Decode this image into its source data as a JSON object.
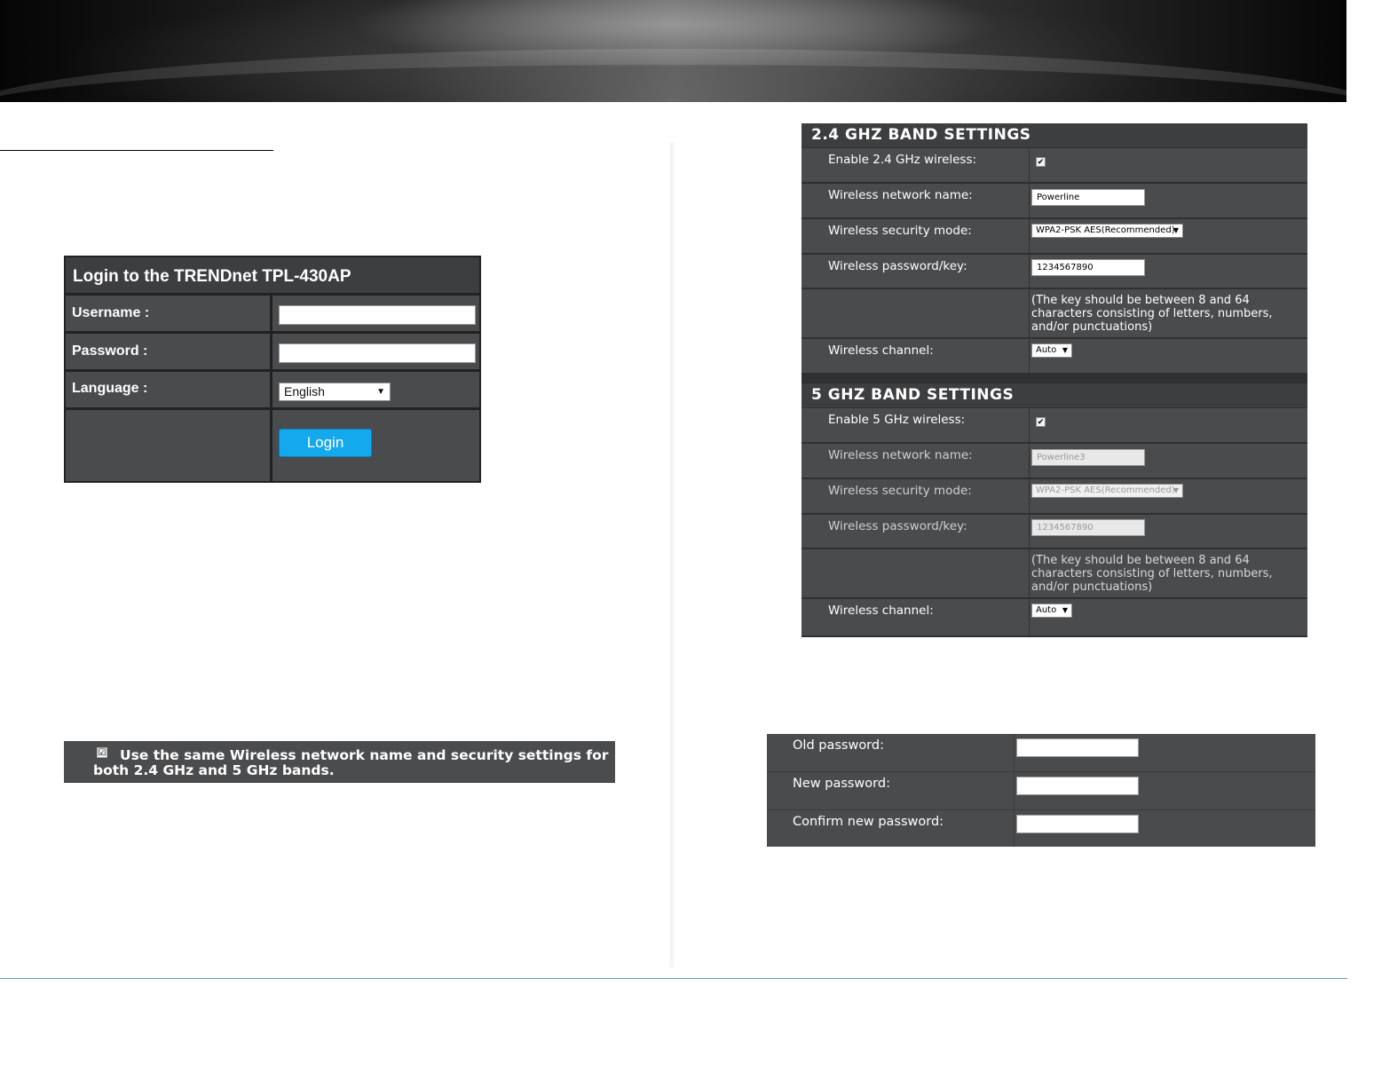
{
  "login": {
    "title": "Login to the TRENDnet TPL-430AP",
    "username_label": "Username :",
    "username_value": "",
    "password_label": "Password :",
    "password_value": "",
    "language_label": "Language :",
    "language_value": "English",
    "login_button": "Login"
  },
  "same_settings": {
    "checked": true,
    "check_glyph": "☑",
    "line1": "Use the same Wireless network name and security settings for",
    "line2": "both 2.4 GHz and 5 GHz bands."
  },
  "band24": {
    "heading": "2.4 GHZ BAND SETTINGS",
    "enable_label": "Enable 2.4 GHz wireless:",
    "enabled": true,
    "check_glyph": "✔",
    "ssid_label": "Wireless network name:",
    "ssid": "Powerline",
    "security_label": "Wireless security mode:",
    "security": "WPA2-PSK AES(Recommended)",
    "key_label": "Wireless password/key:",
    "key": "1234567890",
    "key_note": "(The key should be between 8 and 64 characters consisting of letters, numbers, and/or punctuations)",
    "channel_label": "Wireless channel:",
    "channel": "Auto"
  },
  "band5": {
    "heading": "5 GHZ BAND SETTINGS",
    "enable_label": "Enable 5 GHz wireless:",
    "enabled": true,
    "check_glyph": "✔",
    "ssid_label": "Wireless network name:",
    "ssid": "Powerline3",
    "security_label": "Wireless security mode:",
    "security": "WPA2-PSK AES(Recommended)",
    "key_label": "Wireless password/key:",
    "key": "1234567890",
    "key_note": "(The key should be between 8 and 64 characters consisting of letters, numbers, and/or punctuations)",
    "channel_label": "Wireless channel:",
    "channel": "Auto"
  },
  "password": {
    "old_label": "Old password:",
    "new_label": "New password:",
    "confirm_label": "Confirm new password:"
  },
  "icons": {
    "dropdown_arrow": "▼"
  },
  "colors": {
    "panel_bg": "#4a4b4d",
    "header_bg": "#3d3e40",
    "login_button": "#14a8ec",
    "footer_rule": "#5b9bd5"
  }
}
